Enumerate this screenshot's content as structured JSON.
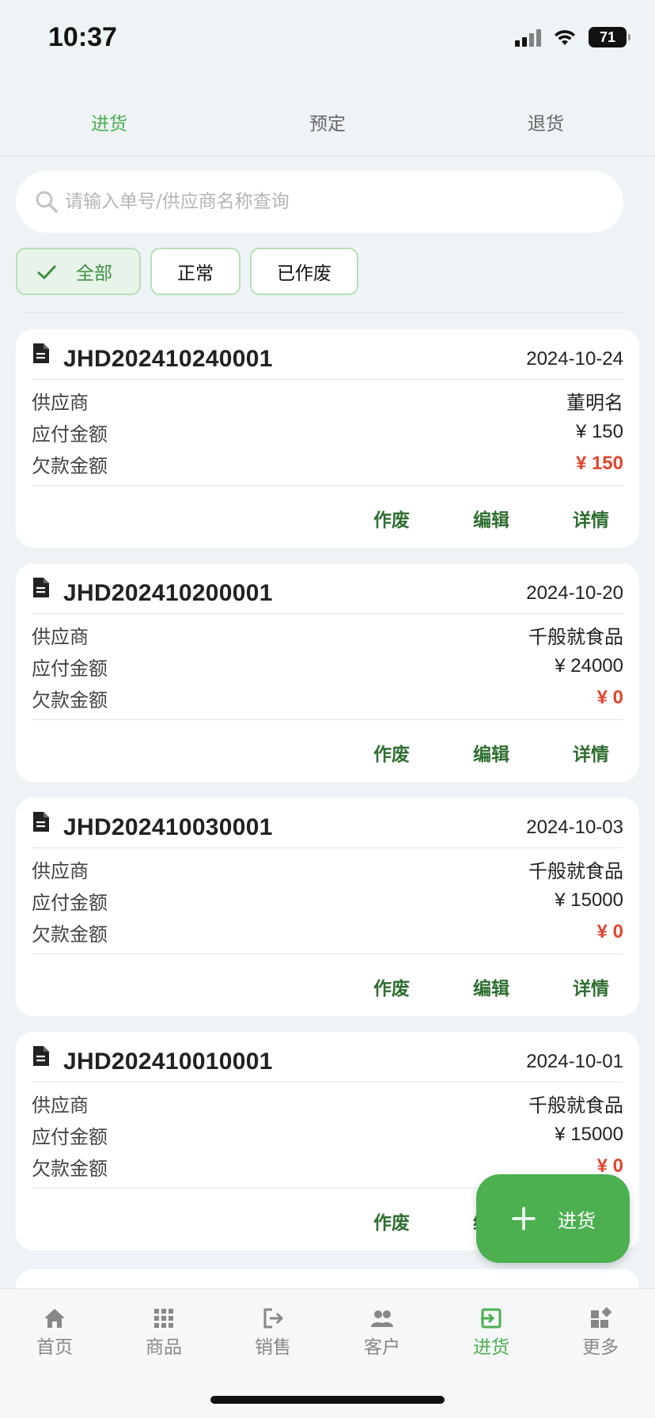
{
  "status_bar": {
    "time": "10:37",
    "battery": "71"
  },
  "tabs": [
    {
      "label": "进货",
      "active": true
    },
    {
      "label": "预定",
      "active": false
    },
    {
      "label": "退货",
      "active": false
    }
  ],
  "search": {
    "placeholder": "请输入单号/供应商名称查询",
    "value": ""
  },
  "filters": [
    {
      "label": "全部",
      "active": true
    },
    {
      "label": "正常",
      "active": false
    },
    {
      "label": "已作废",
      "active": false
    }
  ],
  "labels": {
    "supplier": "供应商",
    "payable": "应付金额",
    "debt": "欠款金额"
  },
  "actions": {
    "void": "作废",
    "edit": "编辑",
    "detail": "详情"
  },
  "orders": [
    {
      "no": "JHD202410240001",
      "date": "2024-10-24",
      "supplier": "董明名",
      "payable": "¥ 150",
      "debt": "¥ 150"
    },
    {
      "no": "JHD202410200001",
      "date": "2024-10-20",
      "supplier": "千般就食品",
      "payable": "¥ 24000",
      "debt": "¥ 0"
    },
    {
      "no": "JHD202410030001",
      "date": "2024-10-03",
      "supplier": "千般就食品",
      "payable": "¥ 15000",
      "debt": "¥ 0"
    },
    {
      "no": "JHD202410010001",
      "date": "2024-10-01",
      "supplier": "千般就食品",
      "payable": "¥ 15000",
      "debt": "¥ 0"
    }
  ],
  "fab": {
    "label": "进货"
  },
  "bottom_nav": [
    {
      "label": "首页",
      "icon": "home-icon",
      "active": false
    },
    {
      "label": "商品",
      "icon": "grid-icon",
      "active": false
    },
    {
      "label": "销售",
      "icon": "export-icon",
      "active": false
    },
    {
      "label": "客户",
      "icon": "people-icon",
      "active": false
    },
    {
      "label": "进货",
      "icon": "import-icon",
      "active": true
    },
    {
      "label": "更多",
      "icon": "more-widgets-icon",
      "active": false
    }
  ],
  "colors": {
    "accent": "#4caf50",
    "action": "#2f6e31",
    "debt": "#e0462e"
  }
}
